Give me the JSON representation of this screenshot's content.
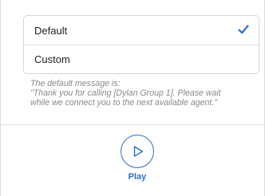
{
  "options": [
    {
      "label": "Default",
      "selected": true
    },
    {
      "label": "Custom",
      "selected": false
    }
  ],
  "message": {
    "line1": "The default message is:",
    "line2": "\"Thank you for calling [Dylan Group 1]. Please wait",
    "line3": "while we connect you to the next available agent.\""
  },
  "play": {
    "label": "Play",
    "icon": "play-icon"
  },
  "colors": {
    "accent": "#2c6fbf",
    "muted_text": "#8a8a8a",
    "border": "#d6d6d6"
  }
}
